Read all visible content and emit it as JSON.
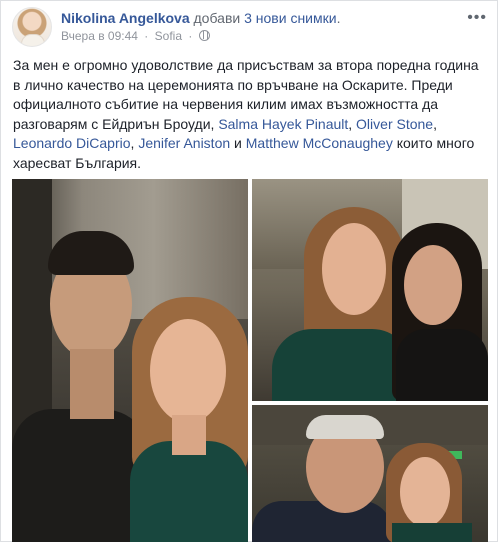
{
  "header": {
    "author_name": "Nikolina Angelkova",
    "action_prefix": "добави",
    "action_link": "3 нови снимки",
    "action_suffix": ".",
    "timestamp": "Вчера в 09:44",
    "separator": "·",
    "location": "Sofia",
    "menu_label": "•••"
  },
  "post": {
    "text_part1": "За мен е огромно удоволствие да присъствам за втора поредна година в лично качество на церемонията по връчване на Оскарите. Преди официалното събитие на червения килим имах възможността да разговарям с Ейдриън Броуди, ",
    "tag1": "Salma Hayek Pinault",
    "comma1": ", ",
    "tag2": "Oliver Stone",
    "comma2": ", ",
    "tag3": "Leonardo DiCaprio",
    "comma3": ", ",
    "tag4": "Jenifer Aniston",
    "and_word": " и ",
    "tag5": "Matthew McConaughey",
    "text_end": " които много харесват България."
  },
  "colors": {
    "link": "#365899",
    "meta": "#90949c",
    "text": "#1d2129"
  }
}
